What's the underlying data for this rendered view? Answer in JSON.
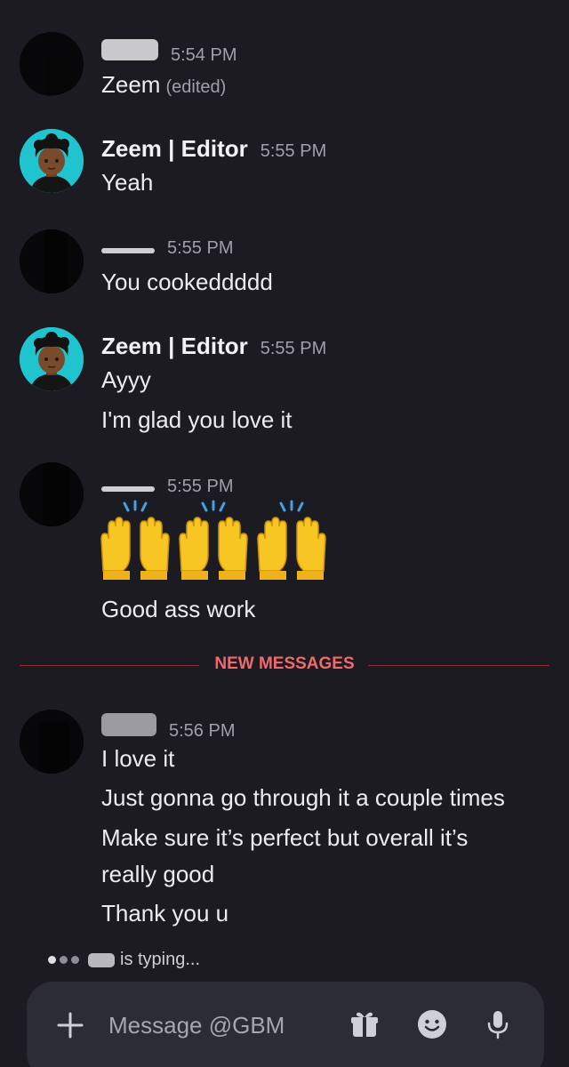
{
  "messages": [
    {
      "author_visible": "",
      "time": "5:54 PM",
      "lines": [
        "Zeem"
      ],
      "edited": "(edited)"
    },
    {
      "author": "Zeem | Editor",
      "time": "5:55 PM",
      "lines": [
        "Yeah"
      ]
    },
    {
      "author_visible": "",
      "time": "5:55 PM",
      "lines": [
        "You cookeddddd"
      ]
    },
    {
      "author": "Zeem | Editor",
      "time": "5:55 PM",
      "lines": [
        "Ayyy",
        "I'm glad you love it"
      ]
    },
    {
      "author_visible": "",
      "time": "5:55 PM",
      "emoji": "raising-hands",
      "emoji_count": 3,
      "lines": [
        "Good ass work"
      ]
    },
    {
      "author_visible": "",
      "time": "5:56 PM",
      "lines": [
        "I love it",
        "Just gonna go through it a couple times",
        "Make sure it’s perfect but overall it’s",
        "really good",
        "Thank you u"
      ]
    }
  ],
  "divider": {
    "label": "NEW MESSAGES",
    "color": "#f06a6d"
  },
  "typing": {
    "text": "is typing..."
  },
  "composer": {
    "placeholder": "Message @GBM",
    "icons": [
      "plus-icon",
      "gift-icon",
      "emoji-icon",
      "microphone-icon"
    ]
  },
  "colors": {
    "background": "#1b1b21",
    "composer": "#2c2d34",
    "zeem_avatar": "#1fc4cf"
  }
}
